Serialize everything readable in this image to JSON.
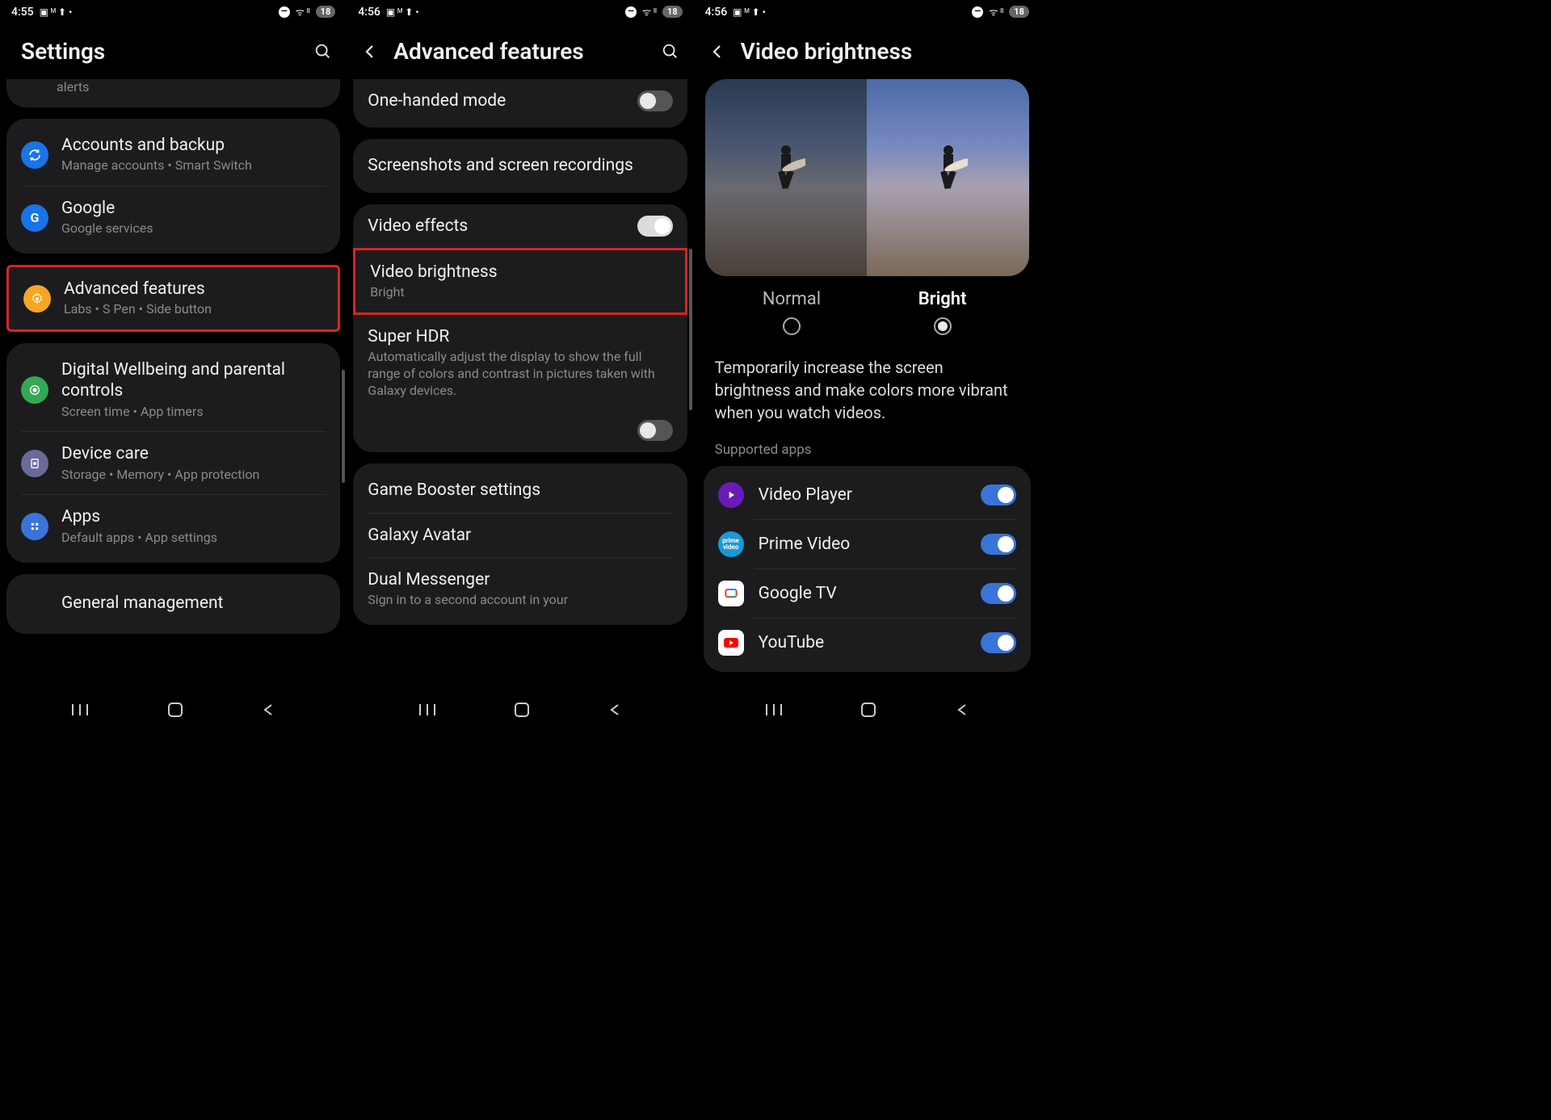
{
  "status": {
    "time_a": "4:55",
    "time_b": "4:56",
    "battery": "18"
  },
  "screen1": {
    "title": "Settings",
    "partial": "alerts",
    "items": {
      "accounts": {
        "title": "Accounts and backup",
        "sub": "Manage accounts  •  Smart Switch"
      },
      "google": {
        "title": "Google",
        "sub": "Google services"
      },
      "advanced": {
        "title": "Advanced features",
        "sub": "Labs  •  S Pen  •  Side button"
      },
      "wellbeing": {
        "title": "Digital Wellbeing and parental controls",
        "sub": "Screen time  •  App timers"
      },
      "device": {
        "title": "Device care",
        "sub": "Storage  •  Memory  •  App protection"
      },
      "apps": {
        "title": "Apps",
        "sub": "Default apps  •  App settings"
      },
      "general": {
        "title": "General management"
      }
    }
  },
  "screen2": {
    "title": "Advanced features",
    "items": {
      "onehand": "One-handed mode",
      "screenshots": "Screenshots and screen recordings",
      "videoeffects": "Video effects",
      "videobright": {
        "title": "Video brightness",
        "sub": "Bright"
      },
      "superhdr": {
        "title": "Super HDR",
        "sub": "Automatically adjust the display to show the full range of colors and contrast in pictures taken with Galaxy devices."
      },
      "gamebooster": "Game Booster settings",
      "avatar": "Galaxy Avatar",
      "dual": {
        "title": "Dual Messenger",
        "sub": "Sign in to a second account in your"
      }
    }
  },
  "screen3": {
    "title": "Video brightness",
    "normal": "Normal",
    "bright": "Bright",
    "desc": "Temporarily increase the screen brightness and make colors more vibrant when you watch videos.",
    "supported": "Supported apps",
    "apps": {
      "videoplayer": "Video Player",
      "prime": "Prime Video",
      "googletv": "Google TV",
      "youtube": "YouTube"
    }
  }
}
